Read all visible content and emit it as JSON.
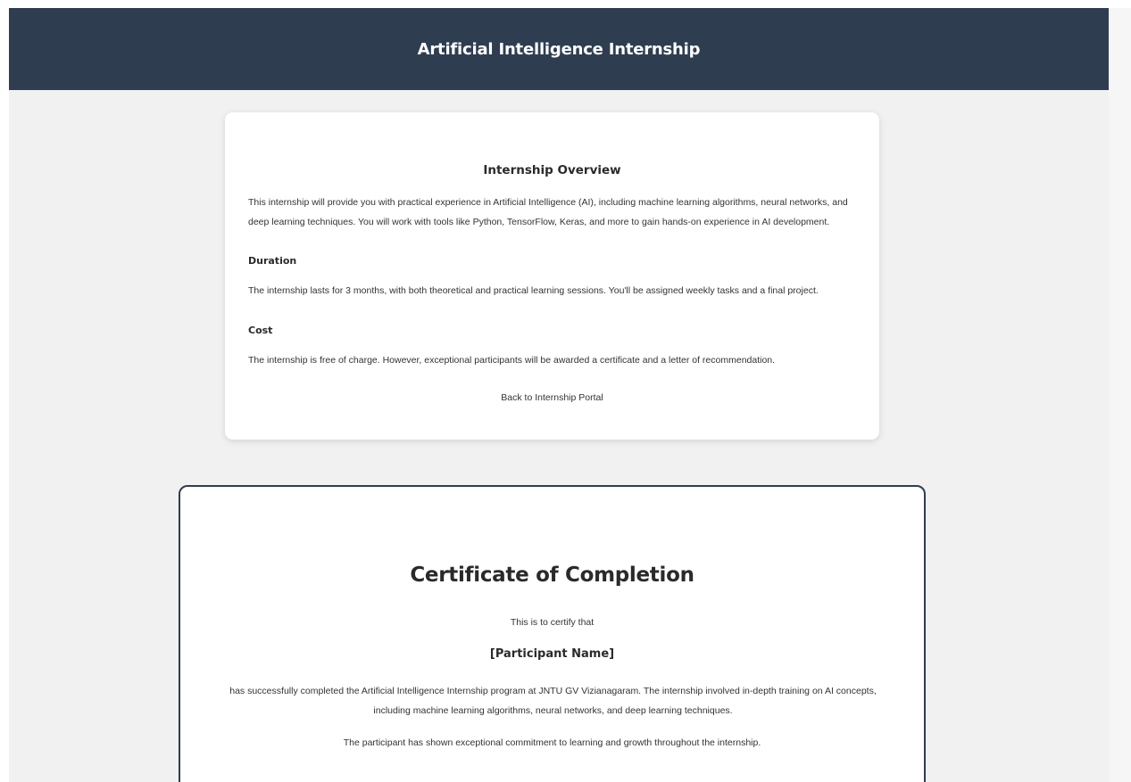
{
  "header": {
    "title": "Artificial Intelligence Internship"
  },
  "overview": {
    "title": "Internship Overview",
    "intro": "This internship will provide you with practical experience in Artificial Intelligence (AI), including machine learning algorithms, neural networks, and deep learning techniques. You will work with tools like Python, TensorFlow, Keras, and more to gain hands-on experience in AI development.",
    "duration_heading": "Duration",
    "duration_text": "The internship lasts for 3 months, with both theoretical and practical learning sessions. You'll be assigned weekly tasks and a final project.",
    "cost_heading": "Cost",
    "cost_text": "The internship is free of charge. However, exceptional participants will be awarded a certificate and a letter of recommendation.",
    "back_link": "Back to Internship Portal"
  },
  "certificate": {
    "title": "Certificate of Completion",
    "certify_line": "This is to certify that",
    "participant_name": "[Participant Name]",
    "body": "has successfully completed the Artificial Intelligence Internship program at JNTU GV Vizianagaram. The internship involved in-depth training on AI concepts, including machine learning algorithms, neural networks, and deep learning techniques.",
    "commitment": "The participant has shown exceptional commitment to learning and growth throughout the internship."
  },
  "colors": {
    "header_bg": "#2e3e50",
    "page_bg": "#f1f1f1",
    "card_bg": "#ffffff"
  }
}
